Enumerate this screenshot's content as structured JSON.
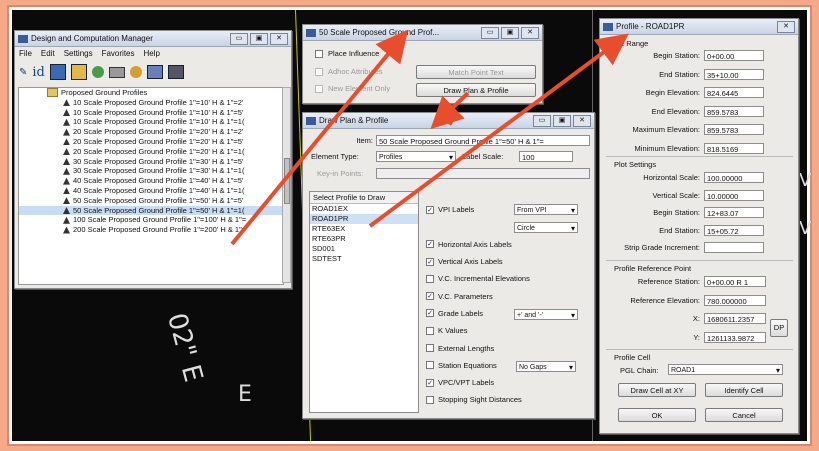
{
  "cad_text": [
    "02\" E",
    "E",
    "V",
    "V"
  ],
  "dcm": {
    "title": "Design and Computation Manager",
    "menu": [
      "File",
      "Edit",
      "Settings",
      "Favorites",
      "Help"
    ],
    "toolbar_id": "id",
    "tree_root": "Proposed Ground Profiles",
    "tree_items": [
      "10 Scale Proposed Ground Profile 1\"=10' H & 1\"=2'",
      "10 Scale Proposed Ground Profile 1\"=10' H & 1\"=5'",
      "10 Scale Proposed Ground Profile 1\"=10' H & 1\"=1(",
      "20 Scale Proposed Ground Profile 1\"=20' H & 1\"=2'",
      "20 Scale Proposed Ground Profile 1\"=20' H & 1\"=5'",
      "20 Scale Proposed Ground Profile 1\"=20' H & 1\"=1(",
      "30 Scale Proposed Ground Profile 1\"=30' H & 1\"=5'",
      "30 Scale Proposed Ground Profile 1\"=30' H & 1\"=1(",
      "40 Scale Proposed Ground Profile 1\"=40' H & 1\"=5'",
      "40 Scale Proposed Ground Profile 1\"=40' H & 1\"=1(",
      "50 Scale Proposed Ground Profile 1\"=50' H & 1\"=5'",
      "50 Scale Proposed Ground Profile 1\"=50' H & 1\"=1(",
      "100 Scale Proposed Ground Profile 1\"=100' H & 1\"=",
      "200 Scale Proposed Ground Profile 1\"=200' H & 1\"="
    ],
    "selected_index": 11
  },
  "sp": {
    "title": "50 Scale Proposed Ground Prof...",
    "place_influence": "Place Influence",
    "adhoc": "Adhoc Attributes",
    "new_element": "New Element Only",
    "match_point": "Match Point Text",
    "draw_plan": "Draw Plan & Profile"
  },
  "dpp": {
    "title": "Draw Plan & Profile",
    "item_label": "Item:",
    "item_value": "50 Scale Proposed Ground Profile 1\"=50' H & 1\"=",
    "element_type_label": "Element Type:",
    "element_type_value": "Profiles",
    "label_scale_label": "Label Scale:",
    "label_scale_value": "100",
    "keyin_label": "Key-in Points:",
    "list_header": "Select Profile to Draw",
    "profiles": [
      "ROAD1EX",
      "ROAD1PR",
      "RTE63EX",
      "RTE63PR",
      "SD001",
      "SDTEST"
    ],
    "selected_profile": 1,
    "options": [
      {
        "label": "VPI Labels",
        "checked": true
      },
      {
        "label": "",
        "checked": null
      },
      {
        "label": "Horizontal Axis Labels",
        "checked": true
      },
      {
        "label": "Vertical Axis Labels",
        "checked": true
      },
      {
        "label": "V.C. Incremental Elevations",
        "checked": false
      },
      {
        "label": "V.C. Parameters",
        "checked": true
      },
      {
        "label": "Grade Labels",
        "checked": true
      },
      {
        "label": "K Values",
        "checked": false
      },
      {
        "label": "External Lengths",
        "checked": false
      },
      {
        "label": "Station Equations",
        "checked": false
      },
      {
        "label": "VPC/VPT Labels",
        "checked": true
      },
      {
        "label": "Stopping Sight Distances",
        "checked": false
      }
    ],
    "vpi_select": "From VPI",
    "circle_select": "Circle",
    "grade_select": "+' and '-'",
    "station_eq_select": "No Gaps"
  },
  "prof": {
    "title": "Profile - ROAD1PR",
    "range_legend": "e Range",
    "range": [
      {
        "label": "Begin Station:",
        "value": "0+00.00"
      },
      {
        "label": "End Station:",
        "value": "35+10.00"
      },
      {
        "label": "Begin Elevation:",
        "value": "824.6445"
      },
      {
        "label": "End Elevation:",
        "value": "859.5783"
      },
      {
        "label": "Maximum Elevation:",
        "value": "859.5783"
      },
      {
        "label": "Minimum Elevation:",
        "value": "818.5169"
      }
    ],
    "plot_legend": "Plot Settings",
    "plot": [
      {
        "label": "Horizontal Scale:",
        "value": "100.00000"
      },
      {
        "label": "Vertical Scale:",
        "value": "10.00000"
      },
      {
        "label": "Begin Station:",
        "value": "12+83.07"
      },
      {
        "label": "End Station:",
        "value": "15+05.72"
      },
      {
        "label": "Strip Grade Increment:",
        "value": ""
      }
    ],
    "ref_legend": "Profile Reference Point",
    "ref": [
      {
        "label": "Reference Station:",
        "value": "0+00.00 R 1"
      },
      {
        "label": "Reference Elevation:",
        "value": "780.000000"
      },
      {
        "label": "X:",
        "value": "1680611.2357"
      },
      {
        "label": "Y:",
        "value": "1261133.9872"
      }
    ],
    "dp": "DP",
    "cell_legend": "Profile Cell",
    "pgl_label": "PGL Chain:",
    "pgl_value": "ROAD1",
    "draw_cell": "Draw Cell at XY",
    "identify_cell": "Identify Cell",
    "ok": "OK",
    "cancel": "Cancel"
  }
}
